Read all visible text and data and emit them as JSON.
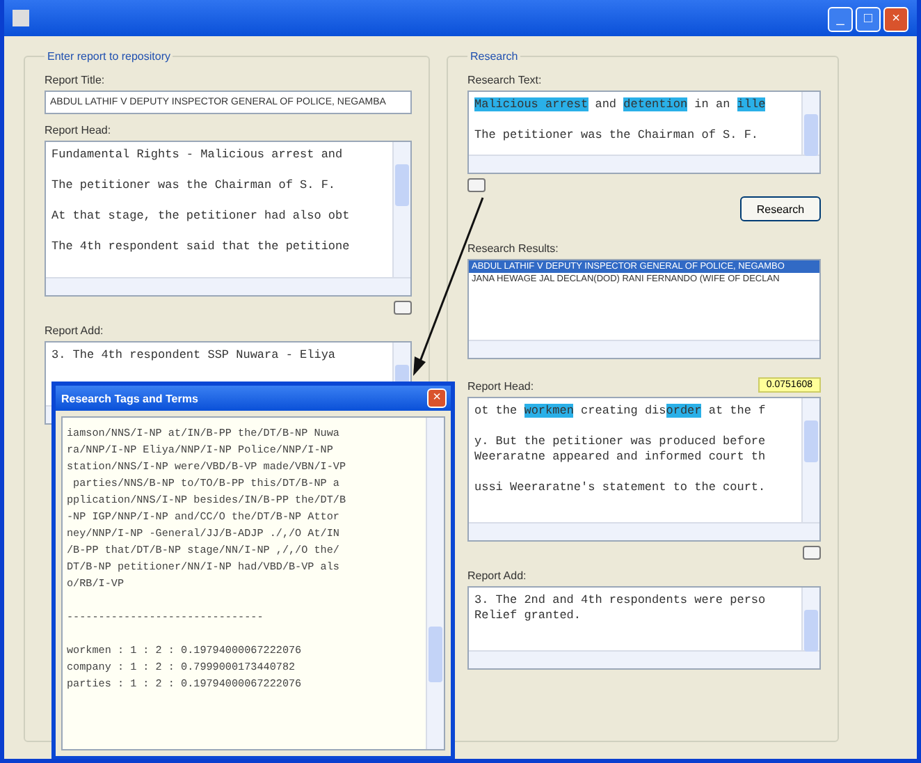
{
  "window": {
    "controls": [
      "_",
      "□",
      "×"
    ]
  },
  "left_group": {
    "title": "Enter report to repository",
    "report_title": {
      "label": "Report Title:",
      "value": "ABDUL LATHIF V DEPUTY INSPECTOR GENERAL OF POLICE, NEGAMBA"
    },
    "report_head": {
      "label": "Report Head:",
      "lines": [
        {
          "text": "Fundamental Rights - Malicious arrest and",
          "gap_before": false
        },
        {
          "text": "The petitioner was the Chairman of S. F.",
          "gap_before": true
        },
        {
          "text": "At that stage, the petitioner had also obt",
          "gap_before": true
        },
        {
          "text": "The 4th respondent said that the petitione",
          "gap_before": true
        }
      ]
    },
    "report_add": {
      "label": "Report Add:",
      "lines": [
        {
          "text": "3. The 4th respondent SSP Nuwara - Eliya",
          "gap_before": false
        }
      ]
    }
  },
  "right_group": {
    "title": "Research",
    "research_text": {
      "label": "Research Text:",
      "lines": [
        {
          "gap_before": false,
          "segments": [
            {
              "text": "Malicious arrest",
              "highlighted": true
            },
            {
              "text": " and ",
              "highlighted": false
            },
            {
              "text": "detention",
              "highlighted": true
            },
            {
              "text": " in an ",
              "highlighted": false
            },
            {
              "text": "ille",
              "highlighted": true
            }
          ]
        },
        {
          "gap_before": true,
          "segments": [
            {
              "text": "The petitioner was the Chairman of S. F.",
              "highlighted": false
            }
          ]
        }
      ]
    },
    "research_button": "Research",
    "results": {
      "label": "Research Results:",
      "items": [
        {
          "text": "ABDUL LATHIF V DEPUTY INSPECTOR GENERAL OF POLICE, NEGAMBO",
          "selected": true
        },
        {
          "text": "JANA HEWAGE JAL DECLAN(DOD) RANI FERNANDO (WIFE OF DECLAN",
          "selected": false
        }
      ]
    },
    "report_head": {
      "label": "Report Head:",
      "score": "0.0751608",
      "lines": [
        {
          "gap_before": false,
          "segments": [
            {
              "text": "ot the ",
              "highlighted": false
            },
            {
              "text": "workmen",
              "highlighted": true
            },
            {
              "text": " creating dis",
              "highlighted": false
            },
            {
              "text": "order",
              "highlighted": true
            },
            {
              "text": " at the f",
              "highlighted": false
            }
          ]
        },
        {
          "gap_before": true,
          "segments": [
            {
              "text": "y. But the petitioner was produced before",
              "highlighted": false
            }
          ]
        },
        {
          "gap_before": false,
          "segments": [
            {
              "text": "Weeraratne appeared and informed court th",
              "highlighted": false
            }
          ]
        },
        {
          "gap_before": true,
          "segments": [
            {
              "text": "ussi Weeraratne's statement to the court.",
              "highlighted": false
            }
          ]
        }
      ]
    },
    "report_add": {
      "label": "Report Add:",
      "lines": [
        {
          "text": "3. The 2nd and 4th respondents were perso",
          "gap_before": false
        },
        {
          "text": "Relief granted.",
          "gap_before": false
        }
      ]
    }
  },
  "dialog": {
    "title": "Research Tags and Terms",
    "lines": [
      {
        "text": "iamson/NNS/I-NP at/IN/B-PP the/DT/B-NP Nuwa",
        "gap_before": false
      },
      {
        "text": "ra/NNP/I-NP Eliya/NNP/I-NP Police/NNP/I-NP",
        "gap_before": false
      },
      {
        "text": "station/NNS/I-NP were/VBD/B-VP made/VBN/I-VP",
        "gap_before": false
      },
      {
        "text": " parties/NNS/B-NP to/TO/B-PP this/DT/B-NP a",
        "gap_before": false
      },
      {
        "text": "pplication/NNS/I-NP besides/IN/B-PP the/DT/B",
        "gap_before": false
      },
      {
        "text": "-NP IGP/NNP/I-NP and/CC/O the/DT/B-NP Attor",
        "gap_before": false
      },
      {
        "text": "ney/NNP/I-NP -General/JJ/B-ADJP ./,/O At/IN",
        "gap_before": false
      },
      {
        "text": "/B-PP that/DT/B-NP stage/NN/I-NP ,/,/O the/",
        "gap_before": false
      },
      {
        "text": "DT/B-NP petitioner/NN/I-NP had/VBD/B-VP als",
        "gap_before": false
      },
      {
        "text": "o/RB/I-VP",
        "gap_before": false
      },
      {
        "text": "-------------------------------",
        "gap_before": true
      },
      {
        "text": "workmen : 1 : 2 : 0.19794000067222076",
        "gap_before": true
      },
      {
        "text": "company : 1 : 2 : 0.7999000173440782",
        "gap_before": false
      },
      {
        "text": "parties : 1 : 2 : 0.19794000067222076",
        "gap_before": false
      }
    ]
  }
}
